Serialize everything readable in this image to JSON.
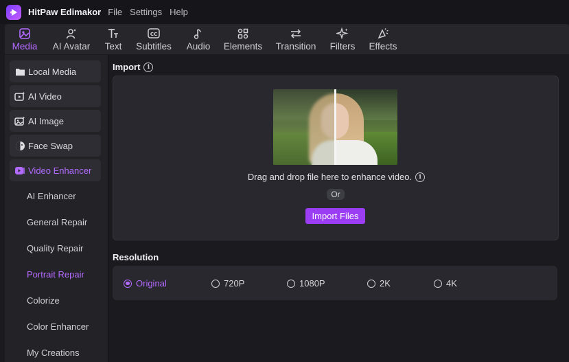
{
  "app": {
    "title": "HitPaw Edimakor"
  },
  "menu": [
    "File",
    "Settings",
    "Help"
  ],
  "toolbar": {
    "tabs": [
      {
        "label": "Media",
        "icon": "media-icon",
        "active": true
      },
      {
        "label": "AI Avatar",
        "icon": "ai-avatar-icon"
      },
      {
        "label": "Text",
        "icon": "text-icon"
      },
      {
        "label": "Subtitles",
        "icon": "subtitles-icon"
      },
      {
        "label": "Audio",
        "icon": "audio-icon"
      },
      {
        "label": "Elements",
        "icon": "elements-icon"
      },
      {
        "label": "Transition",
        "icon": "transition-icon"
      },
      {
        "label": "Filters",
        "icon": "filters-icon"
      },
      {
        "label": "Effects",
        "icon": "effects-icon"
      }
    ]
  },
  "sidebar": {
    "items": [
      {
        "label": "Local Media",
        "icon": "folder-icon"
      },
      {
        "label": "AI Video",
        "icon": "ai-video-icon"
      },
      {
        "label": "AI Image",
        "icon": "ai-image-icon"
      },
      {
        "label": "Face Swap",
        "icon": "face-swap-icon"
      },
      {
        "label": "Video Enhancer",
        "icon": "video-enhancer-icon",
        "active": true
      }
    ],
    "subitems": [
      {
        "label": "AI Enhancer"
      },
      {
        "label": "General Repair"
      },
      {
        "label": "Quality Repair"
      },
      {
        "label": "Portrait Repair",
        "active": true
      },
      {
        "label": "Colorize"
      },
      {
        "label": "Color Enhancer"
      },
      {
        "label": "My Creations"
      }
    ]
  },
  "import": {
    "title": "Import",
    "drop_text": "Drag and drop file here to enhance video.",
    "or_text": "Or",
    "button_label": "Import Files"
  },
  "resolution": {
    "title": "Resolution",
    "options": [
      {
        "label": "Original",
        "selected": true
      },
      {
        "label": "720P"
      },
      {
        "label": "1080P"
      },
      {
        "label": "2K"
      },
      {
        "label": "4K"
      }
    ]
  },
  "colors": {
    "accent": "#b36bff",
    "button": "#9b3df2",
    "background": "#1b1b1f",
    "panel": "#28282e"
  }
}
